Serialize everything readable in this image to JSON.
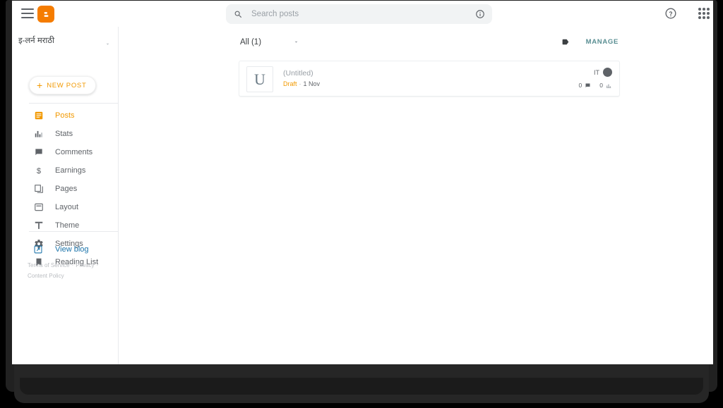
{
  "app": {
    "name": "Blogger",
    "accent_orange": "#f29900",
    "accent_teal": "#5a8f93",
    "link_blue": "#1a73aa"
  },
  "topbar": {
    "menu_icon": "hamburger-icon",
    "logo_icon": "blogger-logo-icon",
    "help_icon": "help-icon",
    "apps_icon": "apps-grid-icon"
  },
  "search": {
    "icon": "search-icon",
    "placeholder": "Search posts",
    "value": "",
    "info_icon": "info-icon"
  },
  "sidebar": {
    "blog_title": "इ-लर्न मराठी",
    "blog_caret_icon": "chevron-down-icon",
    "new_post": {
      "plus": "+",
      "label": "NEW POST"
    },
    "items": [
      {
        "label": "Posts",
        "icon": "posts-icon",
        "active": true
      },
      {
        "label": "Stats",
        "icon": "stats-icon",
        "active": false
      },
      {
        "label": "Comments",
        "icon": "comments-icon",
        "active": false
      },
      {
        "label": "Earnings",
        "icon": "earnings-icon",
        "active": false
      },
      {
        "label": "Pages",
        "icon": "pages-icon",
        "active": false
      },
      {
        "label": "Layout",
        "icon": "layout-icon",
        "active": false
      },
      {
        "label": "Theme",
        "icon": "theme-icon",
        "active": false
      },
      {
        "label": "Settings",
        "icon": "settings-icon",
        "active": false
      },
      {
        "label": "Reading List",
        "icon": "reading-list-icon",
        "active": false
      }
    ],
    "view_blog": {
      "label": "View blog",
      "icon": "open-in-new-icon"
    },
    "footer": {
      "terms": "Terms of Service",
      "privacy": "Privacy",
      "content_policy": "Content Policy",
      "separator": "·"
    }
  },
  "main": {
    "filter": {
      "label": "All (1)",
      "caret_icon": "chevron-down-icon"
    },
    "label_icon": "label-tag-icon",
    "manage_label": "MANAGE",
    "post": {
      "thumbnail_letter": "U",
      "title": "(Untitled)",
      "status": "Draft",
      "separator": "·",
      "date": "1 Nov",
      "author_initials": "IT",
      "avatar_icon": "avatar-icon",
      "comments_count": "0",
      "comments_icon": "comment-icon",
      "views_count": "0",
      "views_icon": "chart-icon"
    }
  }
}
